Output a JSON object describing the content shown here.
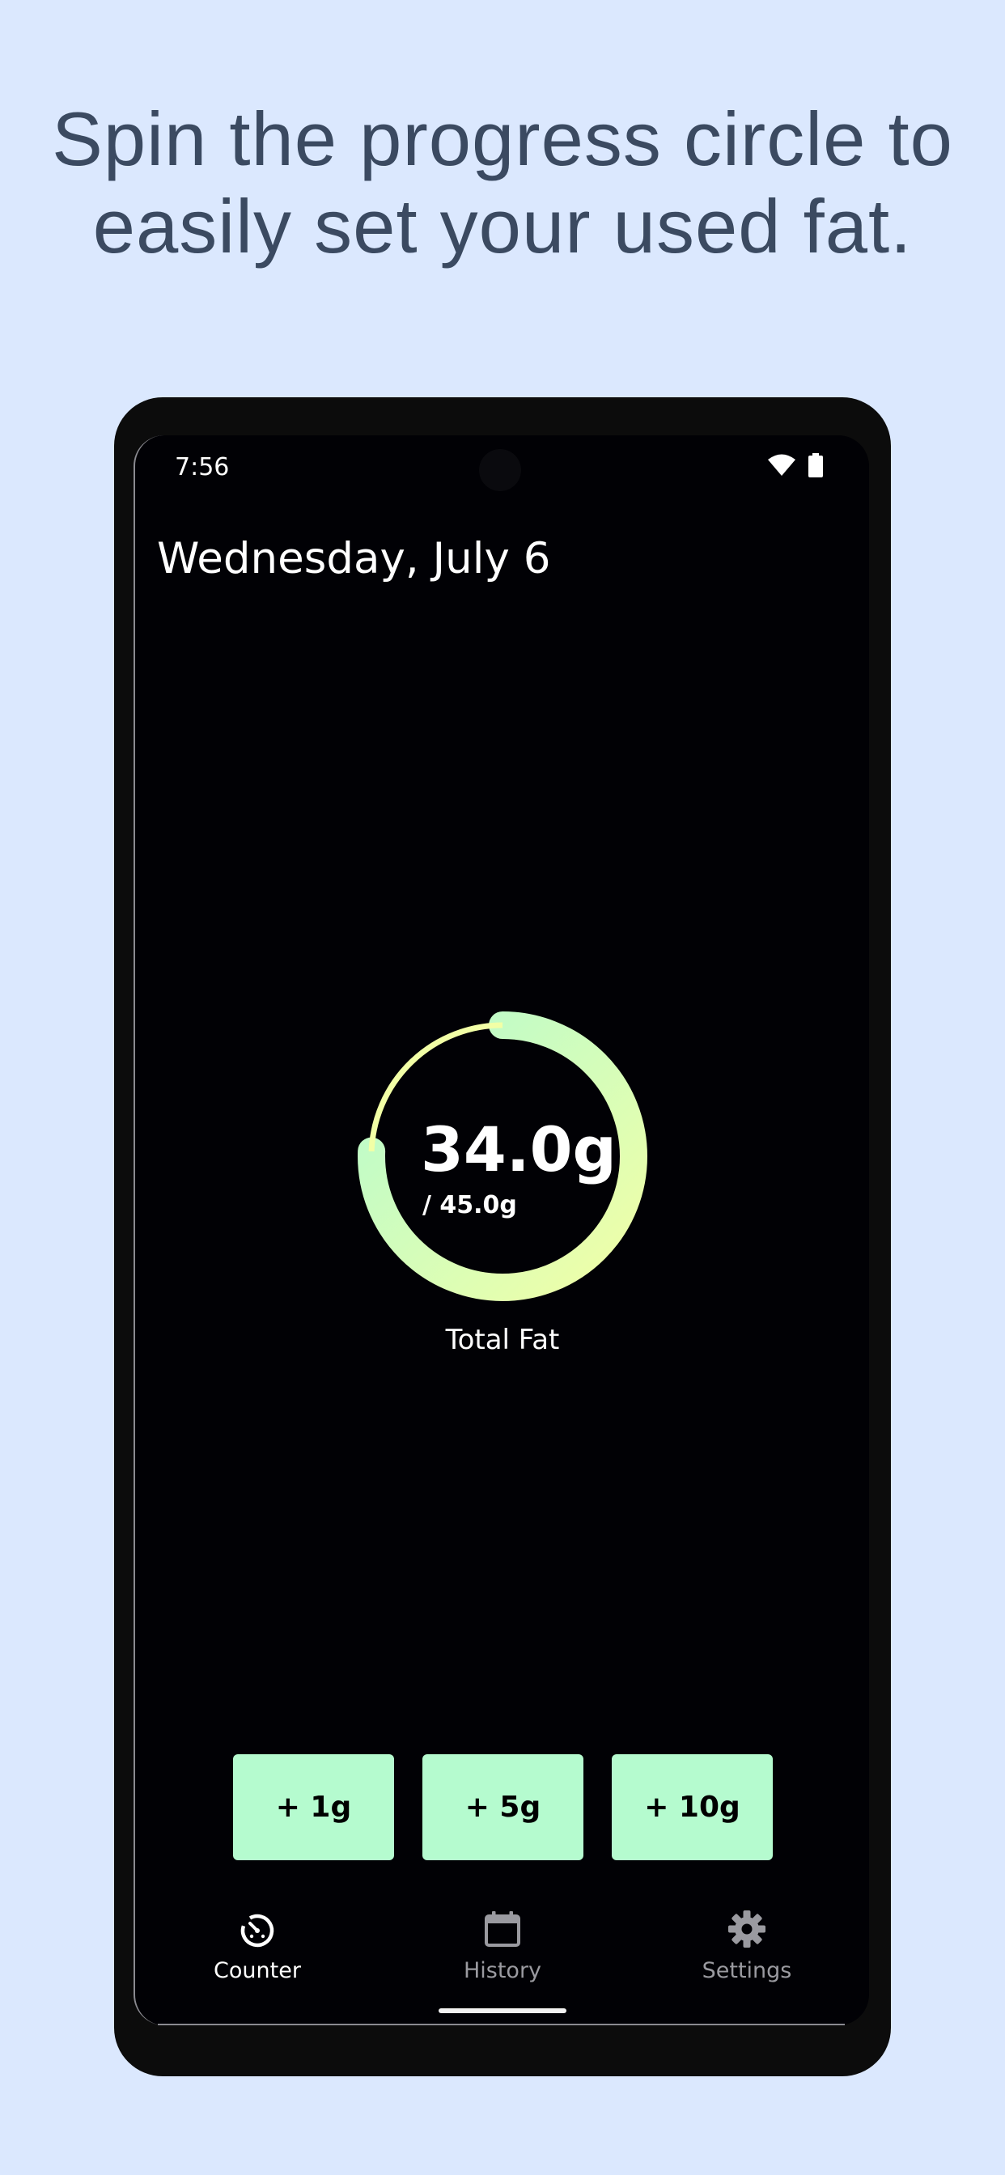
{
  "promo": {
    "line1": "Spin the progress circle to",
    "line2": "easily set your used fat."
  },
  "status_bar": {
    "time": "7:56",
    "icons": [
      "wifi-icon",
      "battery-icon"
    ]
  },
  "screen": {
    "date_title": "Wednesday, July 6"
  },
  "progress": {
    "value_text": "34.0g",
    "goal_text": "/ 45.0g",
    "label": "Total Fat",
    "fraction": 0.756,
    "colors": {
      "start": "#f2ffa6",
      "end": "#b5fbcf"
    }
  },
  "actions": {
    "buttons": [
      {
        "label": "+ 1g"
      },
      {
        "label": "+ 5g"
      },
      {
        "label": "+ 10g"
      }
    ],
    "button_color": "#b5fbcf"
  },
  "nav": {
    "items": [
      {
        "label": "Counter",
        "icon": "gauge-icon",
        "active": true
      },
      {
        "label": "History",
        "icon": "calendar-icon",
        "active": false
      },
      {
        "label": "Settings",
        "icon": "gear-icon",
        "active": false
      }
    ],
    "active_color": "#ffffff",
    "inactive_color": "#9a9aa0"
  }
}
